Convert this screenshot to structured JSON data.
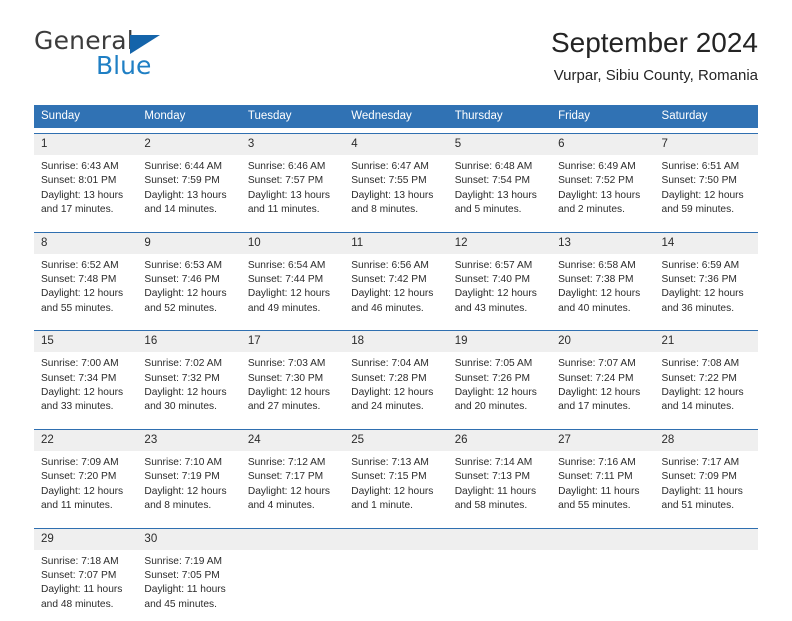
{
  "brand": {
    "name_top": "General",
    "name_bottom": "Blue",
    "flag_icon": "blue-triangle-flag",
    "color_blue": "#1f7fc4",
    "color_dark": "#3c3c3c"
  },
  "header": {
    "title": "September 2024",
    "location": "Vurpar, Sibiu County, Romania"
  },
  "theme": {
    "header_blue": "#3072b4",
    "row_divider_blue": "#2f6fb0",
    "daynum_band": "#efefef",
    "text": "#2b2b2b"
  },
  "weekdays": [
    "Sunday",
    "Monday",
    "Tuesday",
    "Wednesday",
    "Thursday",
    "Friday",
    "Saturday"
  ],
  "weeks": [
    {
      "days": [
        {
          "num": "1",
          "sunrise": "Sunrise: 6:43 AM",
          "sunset": "Sunset: 8:01 PM",
          "daylight_1": "Daylight: 13 hours",
          "daylight_2": "and 17 minutes."
        },
        {
          "num": "2",
          "sunrise": "Sunrise: 6:44 AM",
          "sunset": "Sunset: 7:59 PM",
          "daylight_1": "Daylight: 13 hours",
          "daylight_2": "and 14 minutes."
        },
        {
          "num": "3",
          "sunrise": "Sunrise: 6:46 AM",
          "sunset": "Sunset: 7:57 PM",
          "daylight_1": "Daylight: 13 hours",
          "daylight_2": "and 11 minutes."
        },
        {
          "num": "4",
          "sunrise": "Sunrise: 6:47 AM",
          "sunset": "Sunset: 7:55 PM",
          "daylight_1": "Daylight: 13 hours",
          "daylight_2": "and 8 minutes."
        },
        {
          "num": "5",
          "sunrise": "Sunrise: 6:48 AM",
          "sunset": "Sunset: 7:54 PM",
          "daylight_1": "Daylight: 13 hours",
          "daylight_2": "and 5 minutes."
        },
        {
          "num": "6",
          "sunrise": "Sunrise: 6:49 AM",
          "sunset": "Sunset: 7:52 PM",
          "daylight_1": "Daylight: 13 hours",
          "daylight_2": "and 2 minutes."
        },
        {
          "num": "7",
          "sunrise": "Sunrise: 6:51 AM",
          "sunset": "Sunset: 7:50 PM",
          "daylight_1": "Daylight: 12 hours",
          "daylight_2": "and 59 minutes."
        }
      ]
    },
    {
      "days": [
        {
          "num": "8",
          "sunrise": "Sunrise: 6:52 AM",
          "sunset": "Sunset: 7:48 PM",
          "daylight_1": "Daylight: 12 hours",
          "daylight_2": "and 55 minutes."
        },
        {
          "num": "9",
          "sunrise": "Sunrise: 6:53 AM",
          "sunset": "Sunset: 7:46 PM",
          "daylight_1": "Daylight: 12 hours",
          "daylight_2": "and 52 minutes."
        },
        {
          "num": "10",
          "sunrise": "Sunrise: 6:54 AM",
          "sunset": "Sunset: 7:44 PM",
          "daylight_1": "Daylight: 12 hours",
          "daylight_2": "and 49 minutes."
        },
        {
          "num": "11",
          "sunrise": "Sunrise: 6:56 AM",
          "sunset": "Sunset: 7:42 PM",
          "daylight_1": "Daylight: 12 hours",
          "daylight_2": "and 46 minutes."
        },
        {
          "num": "12",
          "sunrise": "Sunrise: 6:57 AM",
          "sunset": "Sunset: 7:40 PM",
          "daylight_1": "Daylight: 12 hours",
          "daylight_2": "and 43 minutes."
        },
        {
          "num": "13",
          "sunrise": "Sunrise: 6:58 AM",
          "sunset": "Sunset: 7:38 PM",
          "daylight_1": "Daylight: 12 hours",
          "daylight_2": "and 40 minutes."
        },
        {
          "num": "14",
          "sunrise": "Sunrise: 6:59 AM",
          "sunset": "Sunset: 7:36 PM",
          "daylight_1": "Daylight: 12 hours",
          "daylight_2": "and 36 minutes."
        }
      ]
    },
    {
      "days": [
        {
          "num": "15",
          "sunrise": "Sunrise: 7:00 AM",
          "sunset": "Sunset: 7:34 PM",
          "daylight_1": "Daylight: 12 hours",
          "daylight_2": "and 33 minutes."
        },
        {
          "num": "16",
          "sunrise": "Sunrise: 7:02 AM",
          "sunset": "Sunset: 7:32 PM",
          "daylight_1": "Daylight: 12 hours",
          "daylight_2": "and 30 minutes."
        },
        {
          "num": "17",
          "sunrise": "Sunrise: 7:03 AM",
          "sunset": "Sunset: 7:30 PM",
          "daylight_1": "Daylight: 12 hours",
          "daylight_2": "and 27 minutes."
        },
        {
          "num": "18",
          "sunrise": "Sunrise: 7:04 AM",
          "sunset": "Sunset: 7:28 PM",
          "daylight_1": "Daylight: 12 hours",
          "daylight_2": "and 24 minutes."
        },
        {
          "num": "19",
          "sunrise": "Sunrise: 7:05 AM",
          "sunset": "Sunset: 7:26 PM",
          "daylight_1": "Daylight: 12 hours",
          "daylight_2": "and 20 minutes."
        },
        {
          "num": "20",
          "sunrise": "Sunrise: 7:07 AM",
          "sunset": "Sunset: 7:24 PM",
          "daylight_1": "Daylight: 12 hours",
          "daylight_2": "and 17 minutes."
        },
        {
          "num": "21",
          "sunrise": "Sunrise: 7:08 AM",
          "sunset": "Sunset: 7:22 PM",
          "daylight_1": "Daylight: 12 hours",
          "daylight_2": "and 14 minutes."
        }
      ]
    },
    {
      "days": [
        {
          "num": "22",
          "sunrise": "Sunrise: 7:09 AM",
          "sunset": "Sunset: 7:20 PM",
          "daylight_1": "Daylight: 12 hours",
          "daylight_2": "and 11 minutes."
        },
        {
          "num": "23",
          "sunrise": "Sunrise: 7:10 AM",
          "sunset": "Sunset: 7:19 PM",
          "daylight_1": "Daylight: 12 hours",
          "daylight_2": "and 8 minutes."
        },
        {
          "num": "24",
          "sunrise": "Sunrise: 7:12 AM",
          "sunset": "Sunset: 7:17 PM",
          "daylight_1": "Daylight: 12 hours",
          "daylight_2": "and 4 minutes."
        },
        {
          "num": "25",
          "sunrise": "Sunrise: 7:13 AM",
          "sunset": "Sunset: 7:15 PM",
          "daylight_1": "Daylight: 12 hours",
          "daylight_2": "and 1 minute."
        },
        {
          "num": "26",
          "sunrise": "Sunrise: 7:14 AM",
          "sunset": "Sunset: 7:13 PM",
          "daylight_1": "Daylight: 11 hours",
          "daylight_2": "and 58 minutes."
        },
        {
          "num": "27",
          "sunrise": "Sunrise: 7:16 AM",
          "sunset": "Sunset: 7:11 PM",
          "daylight_1": "Daylight: 11 hours",
          "daylight_2": "and 55 minutes."
        },
        {
          "num": "28",
          "sunrise": "Sunrise: 7:17 AM",
          "sunset": "Sunset: 7:09 PM",
          "daylight_1": "Daylight: 11 hours",
          "daylight_2": "and 51 minutes."
        }
      ]
    },
    {
      "days": [
        {
          "num": "29",
          "sunrise": "Sunrise: 7:18 AM",
          "sunset": "Sunset: 7:07 PM",
          "daylight_1": "Daylight: 11 hours",
          "daylight_2": "and 48 minutes."
        },
        {
          "num": "30",
          "sunrise": "Sunrise: 7:19 AM",
          "sunset": "Sunset: 7:05 PM",
          "daylight_1": "Daylight: 11 hours",
          "daylight_2": "and 45 minutes."
        },
        {
          "num": "",
          "sunrise": "",
          "sunset": "",
          "daylight_1": "",
          "daylight_2": ""
        },
        {
          "num": "",
          "sunrise": "",
          "sunset": "",
          "daylight_1": "",
          "daylight_2": ""
        },
        {
          "num": "",
          "sunrise": "",
          "sunset": "",
          "daylight_1": "",
          "daylight_2": ""
        },
        {
          "num": "",
          "sunrise": "",
          "sunset": "",
          "daylight_1": "",
          "daylight_2": ""
        },
        {
          "num": "",
          "sunrise": "",
          "sunset": "",
          "daylight_1": "",
          "daylight_2": ""
        }
      ]
    }
  ]
}
